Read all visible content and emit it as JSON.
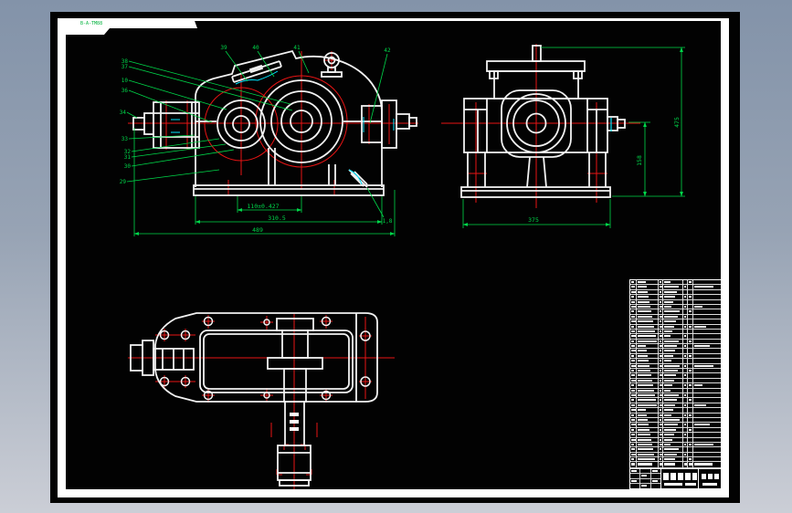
{
  "drawing": {
    "stamp_label": "B-A-TM88",
    "front_view": {
      "callouts_left": [
        "38",
        "37",
        "10",
        "36",
        "34",
        "33",
        "32",
        "31",
        "30",
        "29"
      ],
      "callouts_top": [
        "39",
        "40",
        "41",
        "42"
      ],
      "callout_corner": "1,8",
      "dim_center_distance": "110±0.427",
      "dim_width_mid": "310.5",
      "dim_width_overall": "489"
    },
    "side_view": {
      "dim_height_overall": "475",
      "dim_height_center": "158",
      "dim_width_base": "375"
    },
    "parts_list": {
      "rows": 37
    },
    "colors": {
      "sheet": "#020202",
      "lines": "#f2f2f2",
      "centerlines": "#e81414",
      "dimensions": "#00d84a",
      "details": "#00e5ff",
      "background_top": "#8393a9",
      "background_bottom": "#cbced6"
    }
  }
}
